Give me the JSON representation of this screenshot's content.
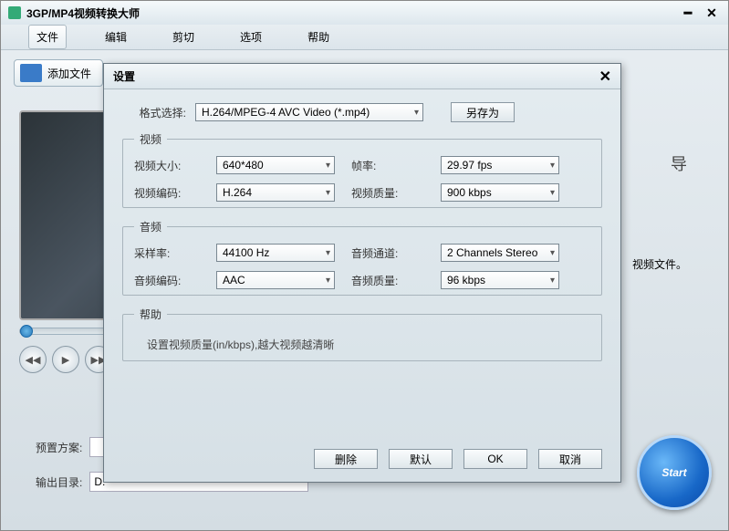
{
  "window": {
    "title": "3GP/MP4视频转换大师"
  },
  "menu": {
    "file": "文件",
    "edit": "编辑",
    "cut": "剪切",
    "options": "选项",
    "help": "帮助"
  },
  "toolbar": {
    "add_file": "添加文件"
  },
  "right": {
    "guide_fragment": "导",
    "no_file": "视频文件。"
  },
  "bottom": {
    "preset_label": "预置方案:",
    "output_label": "输出目录:",
    "output_value": "D:",
    "start": "Start"
  },
  "dialog": {
    "title": "设置",
    "format_label": "格式选择:",
    "format_value": "H.264/MPEG-4 AVC Video (*.mp4)",
    "save_as": "另存为",
    "video_legend": "视频",
    "video_size_label": "视频大小:",
    "video_size_value": "640*480",
    "fps_label": "帧率:",
    "fps_value": "29.97 fps",
    "video_enc_label": "视频编码:",
    "video_enc_value": "H.264",
    "video_quality_label": "视频质量:",
    "video_quality_value": "900 kbps",
    "audio_legend": "音频",
    "sample_label": "采样率:",
    "sample_value": "44100 Hz",
    "channel_label": "音频通道:",
    "channel_value": "2 Channels Stereo",
    "audio_enc_label": "音频编码:",
    "audio_enc_value": "AAC",
    "audio_quality_label": "音频质量:",
    "audio_quality_value": "96 kbps",
    "help_legend": "帮助",
    "help_text": "设置视频质量(in/kbps),越大视频越清晰",
    "delete": "删除",
    "default": "默认",
    "ok": "OK",
    "cancel": "取消"
  }
}
